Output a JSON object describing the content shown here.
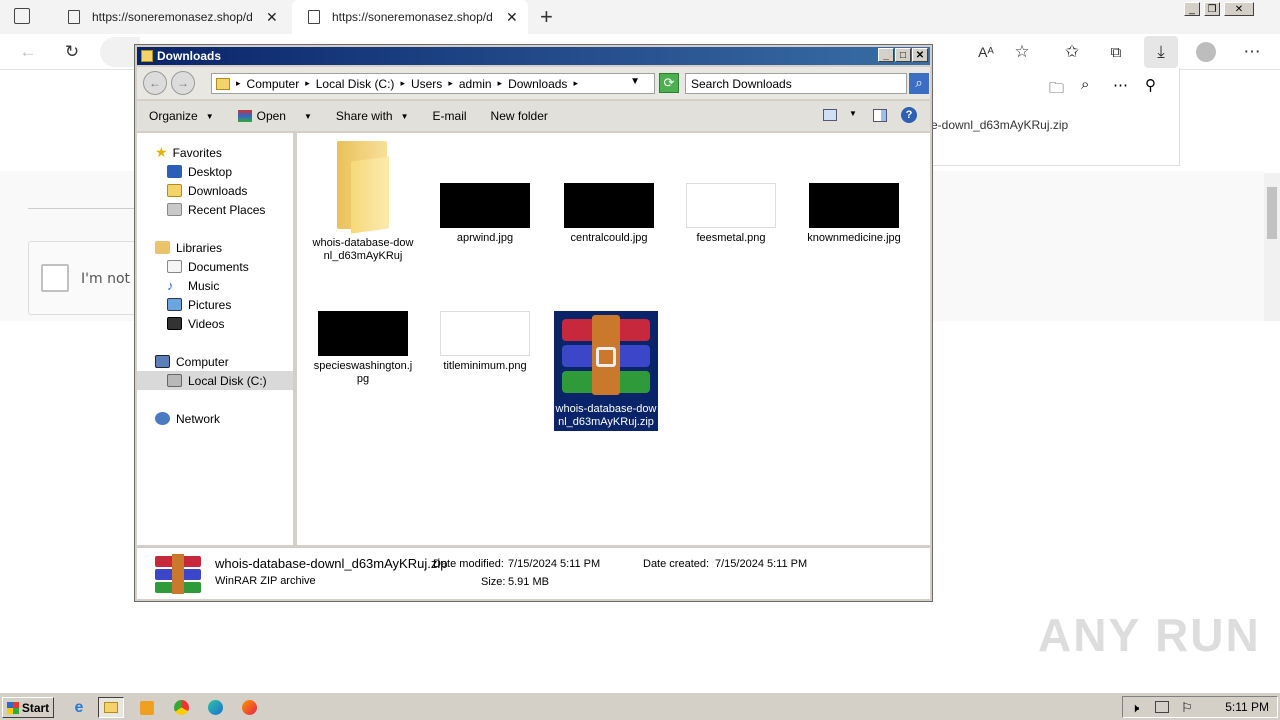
{
  "browser": {
    "tabs": [
      {
        "title": "https://soneremonasez.shop/d"
      },
      {
        "title": "https://soneremonasez.shop/d"
      }
    ],
    "download_item": "e-downl_d63mAyKRuj.zip",
    "page_captcha_text": "I'm not a"
  },
  "explorer": {
    "title": "Downloads",
    "breadcrumb": [
      "Computer",
      "Local Disk (C:)",
      "Users",
      "admin",
      "Downloads"
    ],
    "search_placeholder": "Search Downloads",
    "commands": [
      "Organize",
      "Open",
      "Share with",
      "E-mail",
      "New folder"
    ],
    "nav": {
      "favorites": "Favorites",
      "fav_items": [
        "Desktop",
        "Downloads",
        "Recent Places"
      ],
      "libraries": "Libraries",
      "lib_items": [
        "Documents",
        "Music",
        "Pictures",
        "Videos"
      ],
      "computer": "Computer",
      "local_disk": "Local Disk (C:)",
      "network": "Network"
    },
    "files": [
      {
        "name": "whois-database-downl_d63mAyKRuj",
        "kind": "folder"
      },
      {
        "name": "aprwind.jpg",
        "kind": "dark"
      },
      {
        "name": "centralcould.jpg",
        "kind": "dark"
      },
      {
        "name": "feesmetal.png",
        "kind": "light"
      },
      {
        "name": "knownmedicine.jpg",
        "kind": "dark"
      },
      {
        "name": "specieswashington.jpg",
        "kind": "dark"
      },
      {
        "name": "titleminimum.png",
        "kind": "light"
      },
      {
        "name": "whois-database-downl_d63mAyKRuj.zip",
        "kind": "rar"
      }
    ],
    "details": {
      "filename": "whois-database-downl_d63mAyKRuj.zip",
      "type": "WinRAR ZIP archive",
      "modified_label": "Date modified:",
      "modified": "7/15/2024 5:11 PM",
      "created_label": "Date created:",
      "created": "7/15/2024 5:11 PM",
      "size_label": "Size:",
      "size": "5.91 MB"
    }
  },
  "taskbar": {
    "start": "Start",
    "clock": "5:11 PM"
  },
  "watermark": "ANY RUN"
}
